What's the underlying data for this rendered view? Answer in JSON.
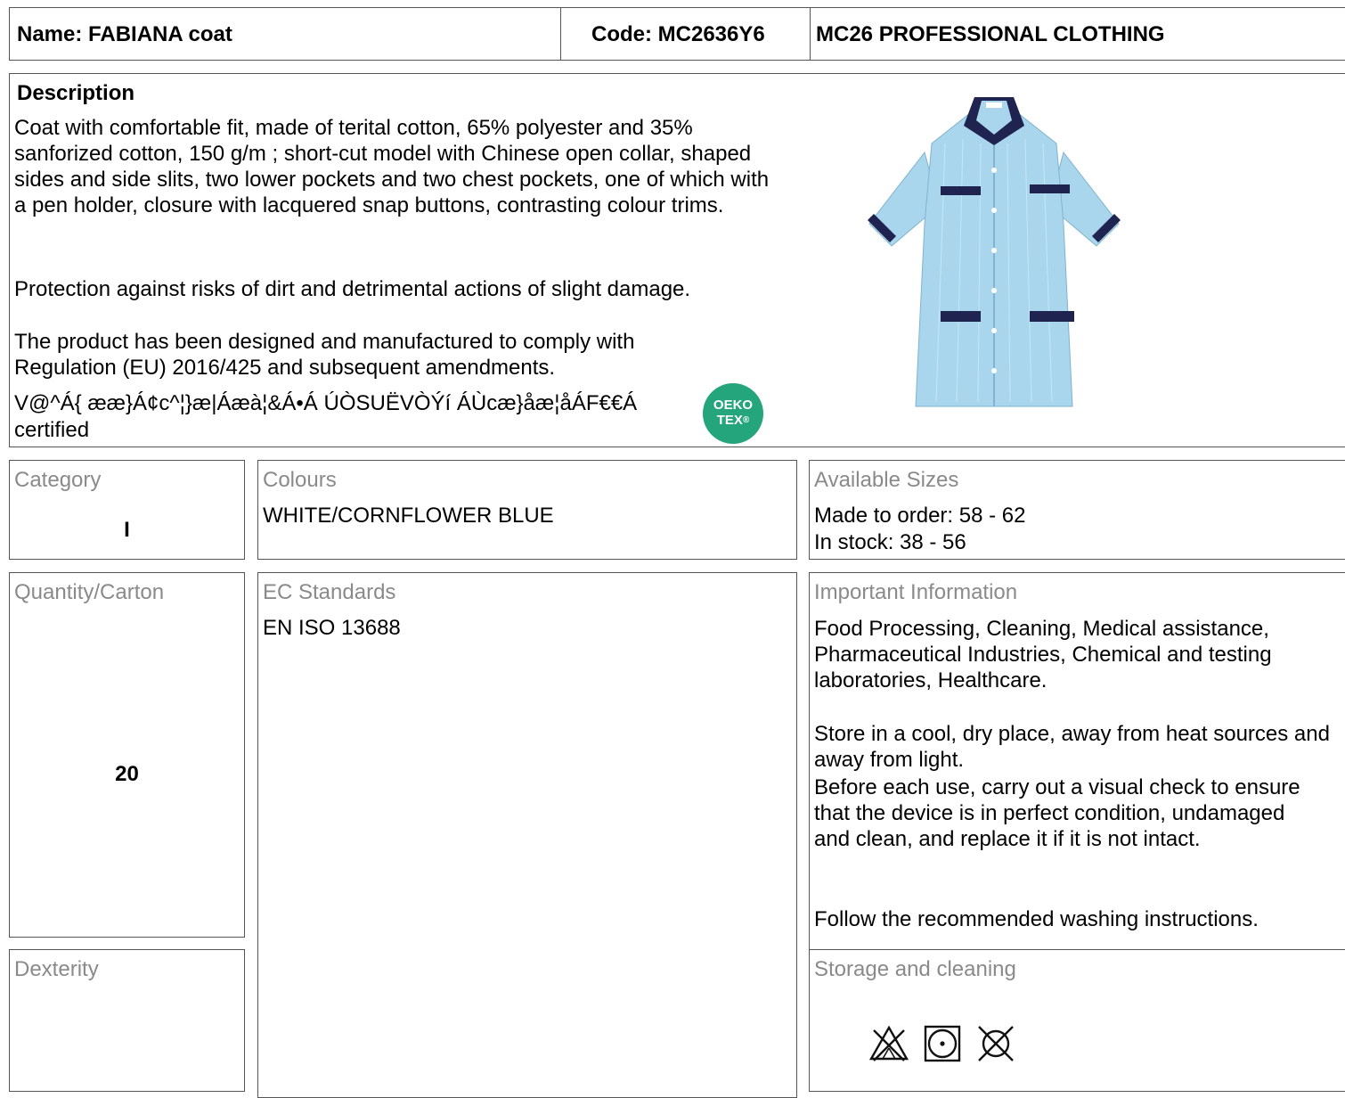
{
  "header": {
    "name": "Name: FABIANA coat",
    "code": "Code: MC2636Y6",
    "brand": "MC26 PROFESSIONAL CLOTHING"
  },
  "description": {
    "heading": "Description",
    "paragraph1": "Coat with comfortable fit, made of terital cotton, 65% polyester and 35% sanforized cotton, 150 g/m ; short-cut model with Chinese open collar, shaped sides and side slits, two lower pockets and two chest pockets, one of which with a pen holder, closure with lacquered snap buttons, contrasting colour trims.",
    "paragraph2": "Protection against risks of dirt and detrimental actions of slight damage.",
    "paragraph3": "The product has been designed and manufactured to comply with Regulation (EU) 2016/425 and subsequent amendments.",
    "garbled_line": "V@^Á{ ææ}Á¢c^¦}æ|Áæà¦&Á•Á ÚÒSUËVÒÝí ÁÙcæ}åæ¦åÁF€€Á",
    "certified": "certified",
    "oeko_badge_line1": "OEKO",
    "oeko_badge_line2": "TEX",
    "oeko_badge_mark": "®"
  },
  "product_image": {
    "icon": "coat-garment-image",
    "body_color": "#a9d6ec",
    "trim_color": "#1e2350"
  },
  "category": {
    "label": "Category",
    "value": "I"
  },
  "colours": {
    "label": "Colours",
    "value": "WHITE/CORNFLOWER BLUE"
  },
  "sizes": {
    "label": "Available Sizes",
    "made_to_order": "Made to order: 58 - 62",
    "in_stock": "In stock: 38 - 56"
  },
  "quantity": {
    "label": "Quantity/Carton",
    "value": "20"
  },
  "ec_standards": {
    "label": "EC Standards",
    "value": "EN ISO 13688"
  },
  "important": {
    "label": "Important Information",
    "p1": "Food Processing, Cleaning, Medical assistance, Pharmaceutical Industries, Chemical and testing laboratories, Healthcare.",
    "p2": "Store in a cool, dry place, away from heat sources and away from light.",
    "p3": "Before each use, carry out a visual check to ensure that the device is in perfect condition, undamaged and clean, and replace it if it is not intact.",
    "p4": "Follow the recommended washing instructions."
  },
  "dexterity": {
    "label": "Dexterity"
  },
  "storage": {
    "label": "Storage and cleaning",
    "icons": [
      "no-bleach-icon",
      "tumble-dry-low-icon",
      "no-dry-clean-icon"
    ]
  }
}
